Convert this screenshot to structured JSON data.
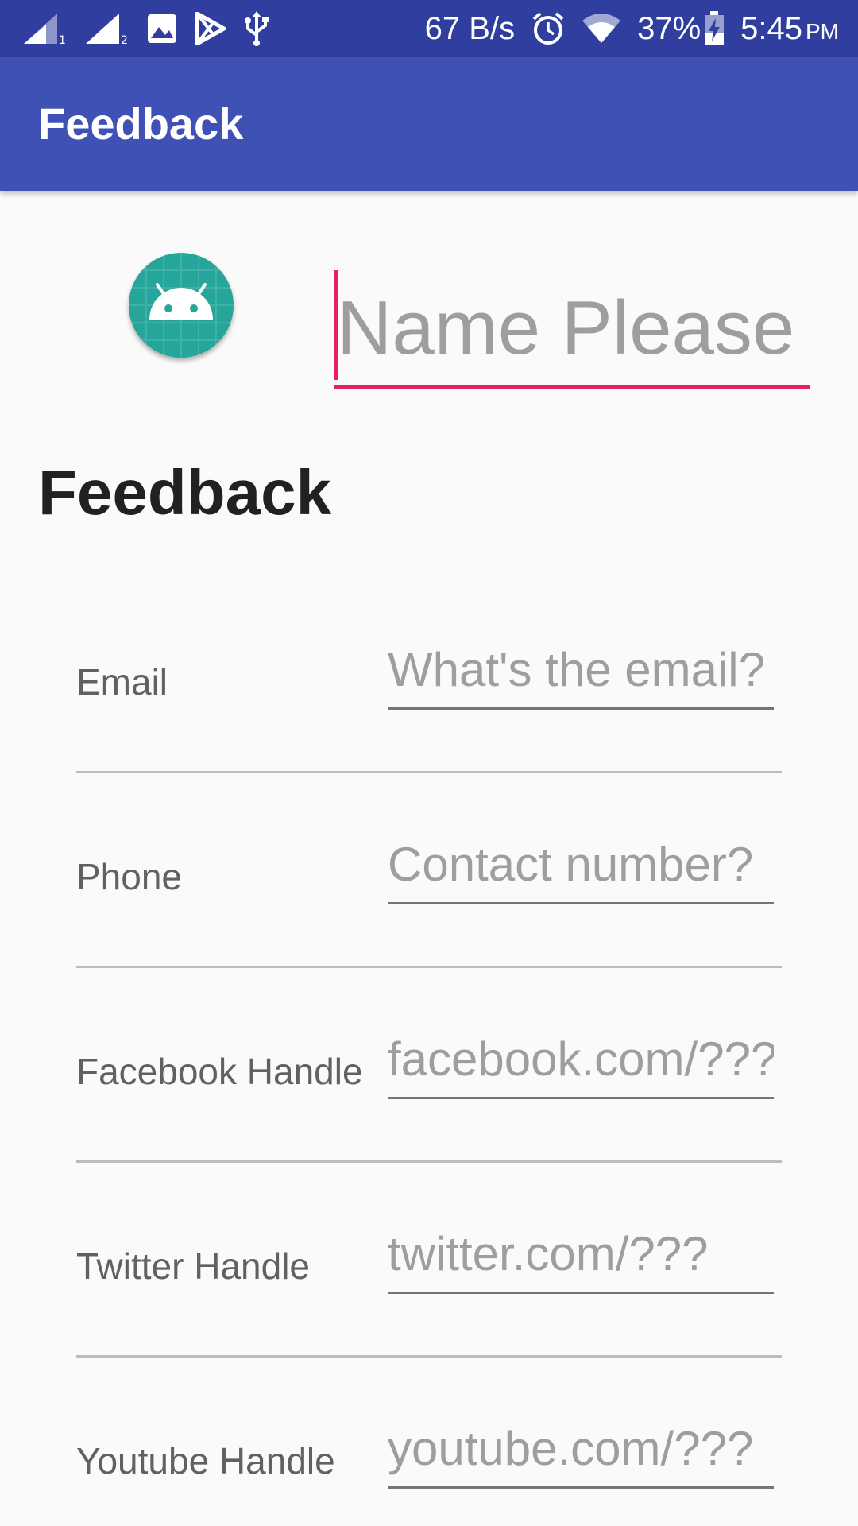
{
  "status_bar": {
    "speed": "67 B/s",
    "battery": "37%",
    "time": "5:45",
    "ampm": "PM",
    "icons": [
      "signal-sim1-icon",
      "signal-sim2-icon",
      "image-icon",
      "play-store-icon",
      "usb-icon",
      "alarm-icon",
      "wifi-icon",
      "battery-charging-icon"
    ]
  },
  "app_bar": {
    "title": "Feedback"
  },
  "profile": {
    "avatar_icon": "android-icon",
    "name_placeholder": "Name Please"
  },
  "section": {
    "heading": "Feedback"
  },
  "form": {
    "fields": [
      {
        "label": "Email",
        "placeholder": "What's the email?"
      },
      {
        "label": "Phone",
        "placeholder": "Contact number?"
      },
      {
        "label": "Facebook Handle",
        "placeholder": "facebook.com/???"
      },
      {
        "label": "Twitter Handle",
        "placeholder": "twitter.com/???"
      },
      {
        "label": "Youtube Handle",
        "placeholder": "youtube.com/???"
      }
    ]
  },
  "colors": {
    "status_bar": "#303f9f",
    "app_bar": "#3f51b5",
    "accent": "#e91e63",
    "avatar_bg": "#26a69a"
  }
}
